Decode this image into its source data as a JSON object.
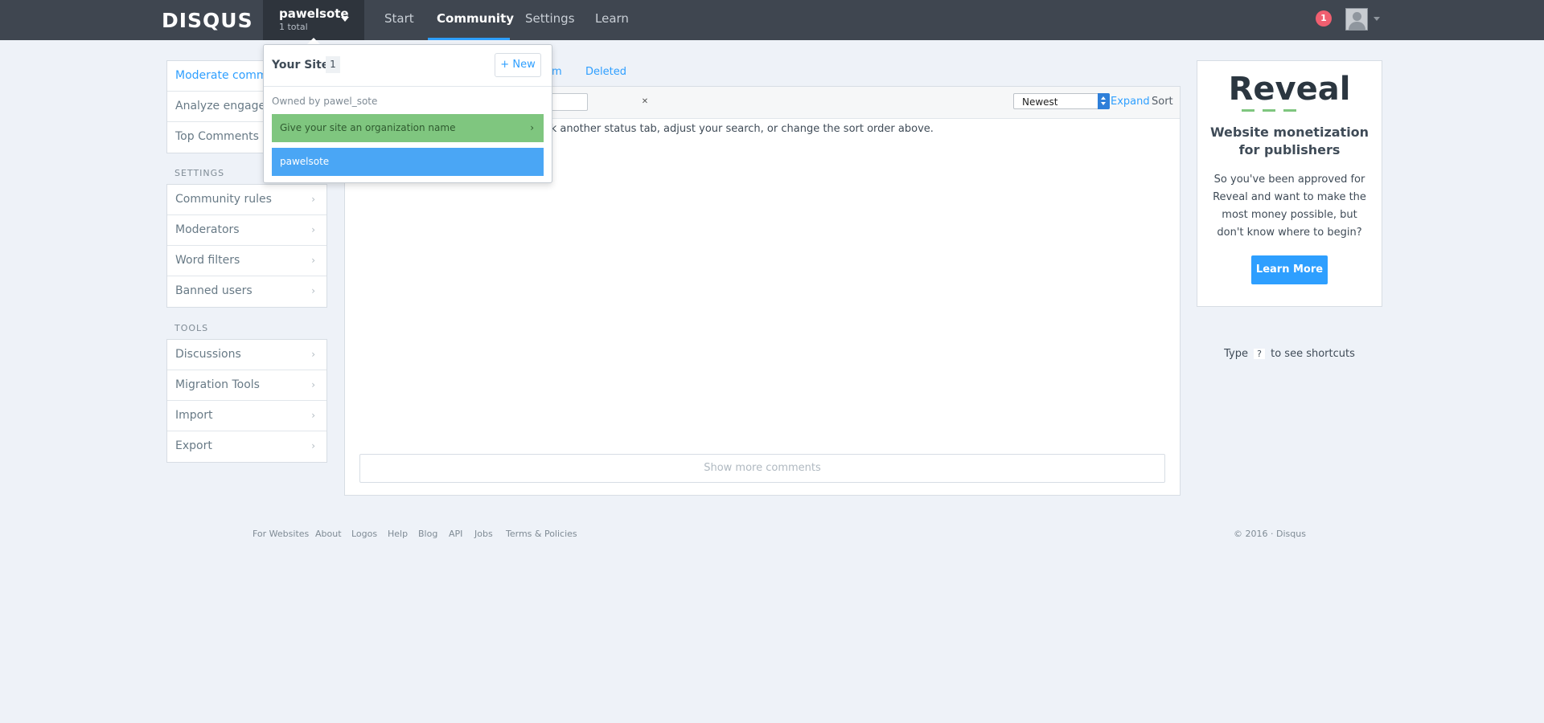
{
  "header": {
    "logo": "DISQUS",
    "site_name": "pawelsote",
    "site_total": "1 total",
    "nav": [
      "Start",
      "Community",
      "Settings",
      "Learn"
    ],
    "notification_count": "1"
  },
  "sites_dropdown": {
    "title": "Your Sites",
    "count": "1",
    "new_label": "New",
    "owned_by": "Owned by pawel_sote",
    "org_prompt": "Give your site an organization name",
    "site_item": "pawelsote"
  },
  "sidebar": {
    "moderate_items": [
      "Moderate comments",
      "Analyze engagement",
      "Top Comments"
    ],
    "settings_heading": "SETTINGS",
    "settings_items": [
      "Community rules",
      "Moderators",
      "Word filters",
      "Banned users"
    ],
    "tools_heading": "TOOLS",
    "tools_items": [
      "Discussions",
      "Migration Tools",
      "Import",
      "Export"
    ]
  },
  "main": {
    "status_tabs": [
      "m",
      "Deleted"
    ],
    "search_placeholder": "ch",
    "sort_value": "Newest",
    "expand_label": "Expand",
    "sort_label": "Sort",
    "empty_message": "ick another status tab, adjust your search, or change the sort order above.",
    "show_more_label": "Show more comments"
  },
  "promo": {
    "logo": "Reveal",
    "headline": "Website monetization for publishers",
    "body": "So you've been approved for Reveal and want to make the most money possible, but don't know where to begin?",
    "button": "Learn More"
  },
  "shortcut": {
    "prefix": "Type",
    "key": "?",
    "suffix": "to see shortcuts"
  },
  "footer": {
    "links": [
      "For Websites",
      "About",
      "Logos",
      "Help",
      "Blog",
      "API",
      "Jobs",
      "Terms & Policies"
    ],
    "copyright": "© 2016 · Disqus"
  },
  "colors": {
    "topbar": "#3f4650",
    "accent": "#2e9fff",
    "org_green": "#7fc67f",
    "site_blue": "#4aa6f5",
    "notification": "#f05f70"
  },
  "icons": {
    "chevron": "chevron-right-icon",
    "plus": "plus-icon",
    "clear": "close-icon",
    "caret": "caret-down-icon",
    "avatar": "user-avatar-icon"
  }
}
